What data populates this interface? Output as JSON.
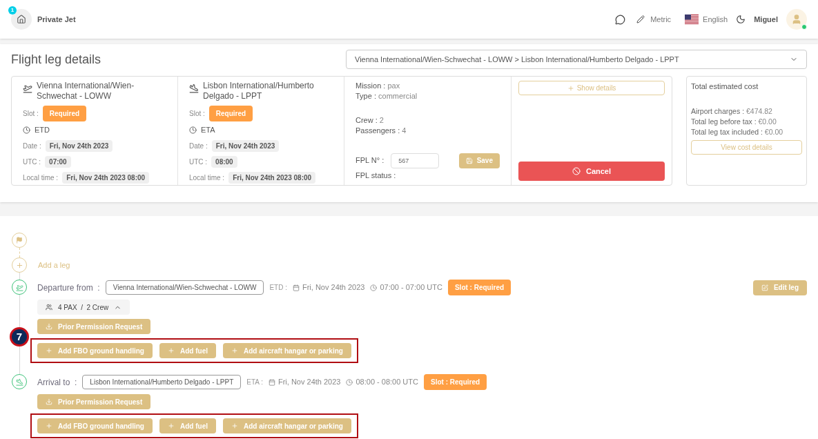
{
  "header": {
    "badge": "1",
    "title": "Private Jet",
    "units": "Metric",
    "language": "English",
    "user": "Miguel",
    "online": true
  },
  "page_title": "Flight leg details",
  "leg_select": "Vienna International/Wien-Schwechat - LOWW > Lisbon International/Humberto Delgado - LPPT",
  "airports": [
    {
      "kind": "departure",
      "name": "Vienna International/Wien-Schwechat - LOWW",
      "slot_label": "Slot :",
      "slot": "Required",
      "time_kind": "ETD",
      "date_label": "Date :",
      "date": "Fri, Nov 24th 2023",
      "utc_label": "UTC :",
      "utc": "07:00",
      "local_label": "Local time :",
      "local": "Fri, Nov 24th 2023 08:00"
    },
    {
      "kind": "arrival",
      "name": "Lisbon International/Humberto Delgado - LPPT",
      "slot_label": "Slot :",
      "slot": "Required",
      "time_kind": "ETA",
      "date_label": "Date :",
      "date": "Fri, Nov 24th 2023",
      "utc_label": "UTC :",
      "utc": "08:00",
      "local_label": "Local time :",
      "local": "Fri, Nov 24th 2023 08:00"
    }
  ],
  "mission": [
    [
      {
        "label": "Mission :",
        "value": "pax"
      },
      {
        "label": "Type :",
        "value": "commercial"
      }
    ],
    [
      {
        "label": "Crew :",
        "value": "2"
      },
      {
        "label": "Passengers :",
        "value": "4"
      }
    ]
  ],
  "fpl": {
    "number_label": "FPL N° :",
    "number": "567",
    "status_label": "FPL status :",
    "save": "Save"
  },
  "actions": {
    "show_details": "Show details",
    "cancel": "Cancel"
  },
  "cost": {
    "title": "Total estimated cost",
    "lines": [
      {
        "label": "Airport charges :",
        "value": "€474.82"
      },
      {
        "label": "Total leg before tax :",
        "value": "€0.00"
      },
      {
        "label": "Total leg tax included :",
        "value": "€0.00"
      }
    ],
    "button": "View cost details"
  },
  "timeline": {
    "add_leg": "Add a leg",
    "stops": [
      {
        "kind": "departure",
        "label": "Departure from  :",
        "airport": "Vienna International/Wien-Schwechat - LOWW",
        "time_label": "ETD :",
        "date": "Fri, Nov 24th 2023",
        "time": "07:00 - 07:00 UTC",
        "slot": "Slot : Required",
        "edit": "Edit leg",
        "people": "4 PAX  /  2 Crew",
        "people_expanded": true,
        "ppr": "Prior Permission Request",
        "services": [
          "Add FBO ground handling",
          "Add fuel",
          "Add aircraft hangar or parking"
        ],
        "callout": "7"
      },
      {
        "kind": "arrival",
        "label": "Arrival to  :",
        "airport": "Lisbon International/Humberto Delgado - LPPT",
        "time_label": "ETA :",
        "date": "Fri, Nov 24th 2023",
        "time": "08:00 - 08:00 UTC",
        "slot": "Slot : Required",
        "ppr": "Prior Permission Request",
        "services": [
          "Add FBO ground handling",
          "Add fuel",
          "Add aircraft hangar or parking"
        ]
      }
    ]
  }
}
